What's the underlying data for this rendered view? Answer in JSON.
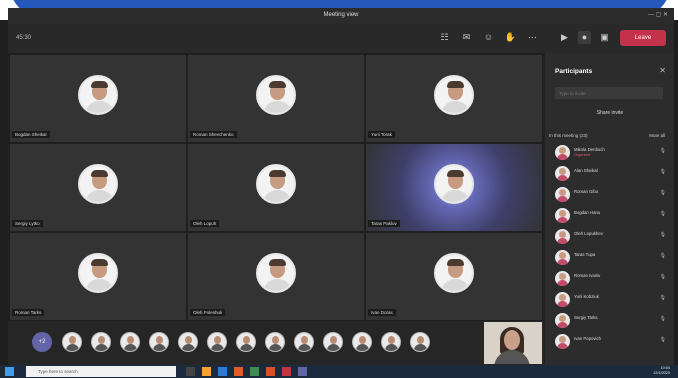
{
  "window": {
    "title": "Meeting view",
    "timer": "45:30"
  },
  "toolbar": {
    "leave_label": "Leave"
  },
  "grid": [
    {
      "name": "Bogdan Sheikal",
      "active": false
    },
    {
      "name": "Roman Shevchenko",
      "active": false
    },
    {
      "name": "Yurii Torak",
      "active": false
    },
    {
      "name": "Sergiy Lytko",
      "active": false
    },
    {
      "name": "Oleh Lopuh",
      "active": false
    },
    {
      "name": "Taras Paklov",
      "active": true
    },
    {
      "name": "Roman Tarks",
      "active": false
    },
    {
      "name": "Oleh Poleshuk",
      "active": false
    },
    {
      "name": "Ivan Doras",
      "active": false
    }
  ],
  "strip": {
    "more_label": "+2"
  },
  "panel": {
    "title": "Participants",
    "invite_placeholder": "Type to invite",
    "share_invite": "Share invite",
    "group_label": "In this meeting (23)",
    "mute_all": "Mute all",
    "participants": [
      {
        "name": "Mikola Derdiuch",
        "role": "Organizer"
      },
      {
        "name": "Alan Sheikal",
        "role": ""
      },
      {
        "name": "Roman Gibo",
        "role": ""
      },
      {
        "name": "Bogdan Hanu",
        "role": ""
      },
      {
        "name": "Oleh Lopukhev",
        "role": ""
      },
      {
        "name": "Taras Tupa",
        "role": ""
      },
      {
        "name": "Roman Ivaniv",
        "role": ""
      },
      {
        "name": "Yurii Kobziuk",
        "role": ""
      },
      {
        "name": "Sergiy Tarks",
        "role": ""
      },
      {
        "name": "Ivan Popovich",
        "role": ""
      }
    ]
  },
  "taskbar": {
    "search_placeholder": "Type here to search",
    "time": "10:54",
    "date": "12/1/2020"
  }
}
